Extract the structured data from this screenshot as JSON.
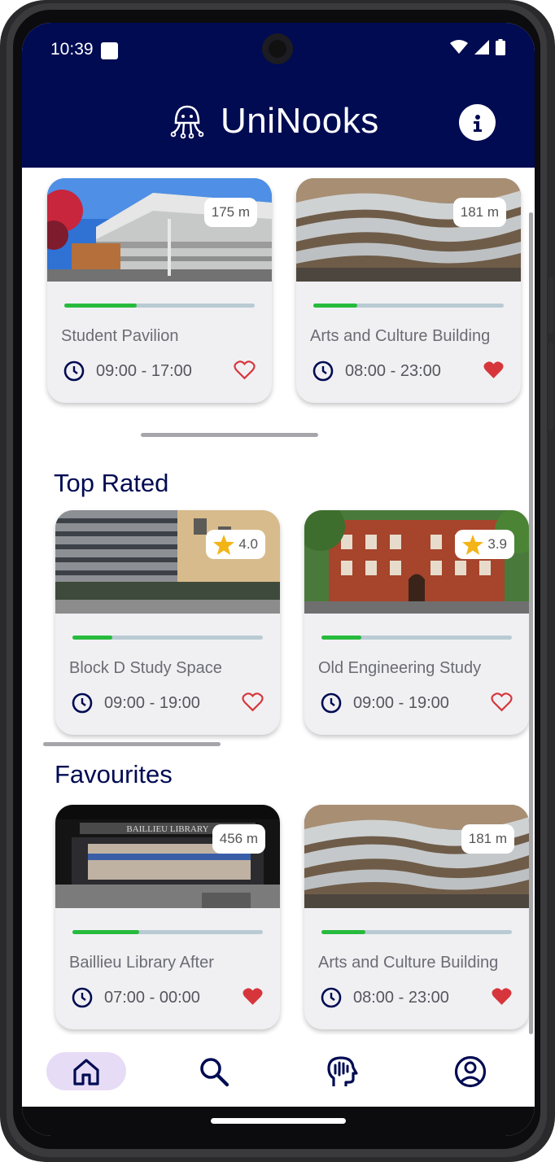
{
  "status": {
    "time": "10:39"
  },
  "app": {
    "title": "UniNooks"
  },
  "sections": {
    "nearby": {
      "cards": [
        {
          "name": "Student Pavilion",
          "distance": "175 m",
          "hours": "09:00 - 17:00",
          "favourite": false,
          "occupancy": 0.38
        },
        {
          "name": "Arts and Culture Building",
          "distance": "181 m",
          "hours": "08:00 - 23:00",
          "favourite": true,
          "occupancy": 0.23
        }
      ]
    },
    "top_rated": {
      "title": "Top Rated",
      "cards": [
        {
          "name": "Block D Study Space",
          "rating": "4.0",
          "hours": "09:00 - 19:00",
          "favourite": false,
          "occupancy": 0.21
        },
        {
          "name": "Old Engineering Study",
          "rating": "3.9",
          "hours": "09:00 - 19:00",
          "favourite": false,
          "occupancy": 0.21
        }
      ]
    },
    "favourites": {
      "title": "Favourites",
      "cards": [
        {
          "name": "Baillieu Library After",
          "distance": "456 m",
          "hours": "07:00 - 00:00",
          "favourite": true,
          "occupancy": 0.35
        },
        {
          "name": "Arts and Culture Building",
          "distance": "181 m",
          "hours": "08:00 - 23:00",
          "favourite": true,
          "occupancy": 0.23
        }
      ]
    }
  },
  "nav": {
    "items": [
      {
        "icon": "home-icon",
        "active": true
      },
      {
        "icon": "search-icon",
        "active": false
      },
      {
        "icon": "brain-head-icon",
        "active": false
      },
      {
        "icon": "account-icon",
        "active": false
      }
    ]
  },
  "colors": {
    "header": "#000b52",
    "accent_green": "#27bb3d",
    "heart_red": "#d6363b",
    "star": "#f2b417",
    "nav_active": "#e7dcf6"
  }
}
